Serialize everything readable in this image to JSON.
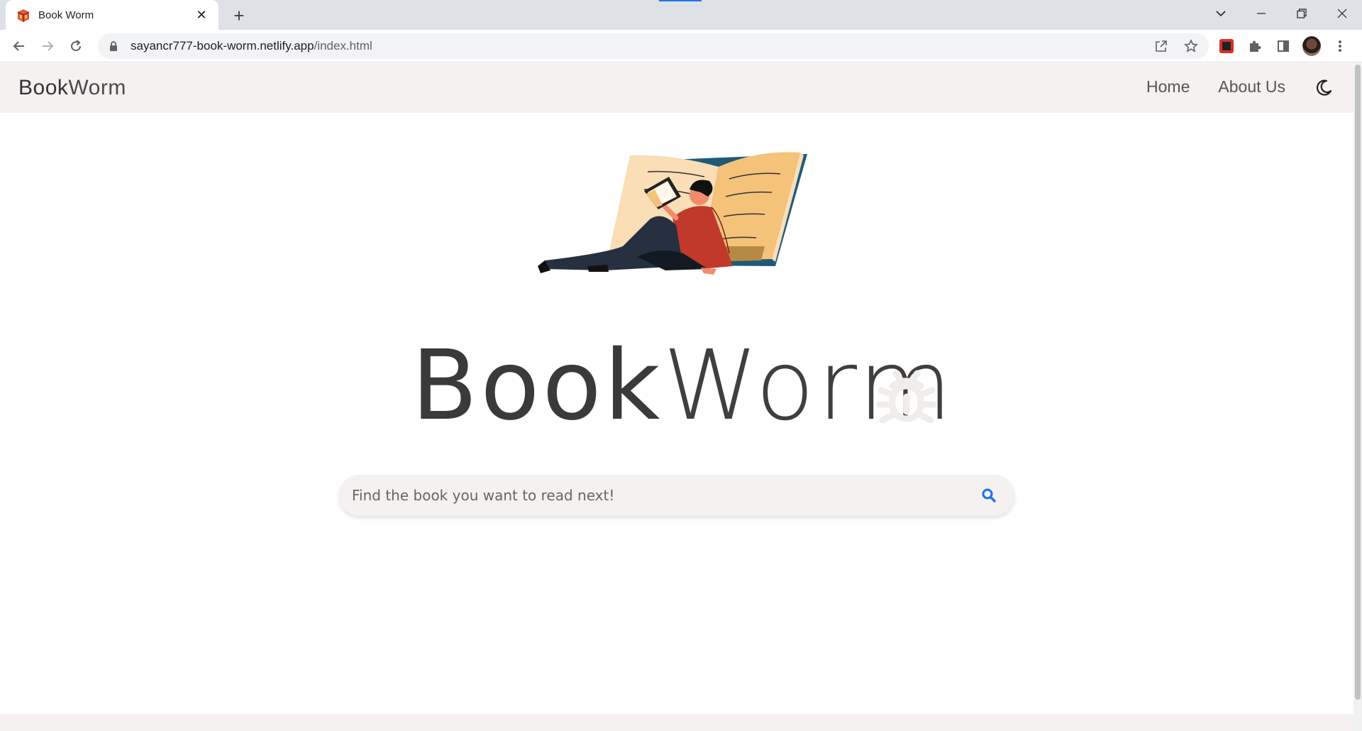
{
  "browser": {
    "tab": {
      "title": "Book Worm",
      "close_glyph": "✕",
      "favicon": "book-box-icon"
    },
    "new_tab_glyph": "+",
    "url": {
      "host": "sayancr777-book-worm.netlify.app",
      "path": "/index.html"
    }
  },
  "site": {
    "brand": {
      "part1": "Book",
      "part2": "Worm"
    },
    "nav": [
      {
        "label": "Home"
      },
      {
        "label": "About Us"
      }
    ],
    "theme_icon": "moon-icon"
  },
  "hero": {
    "logo_part1": "Book",
    "logo_part2": "Worm",
    "logo_icon": "bug-icon"
  },
  "search": {
    "placeholder": "Find the book you want to read next!",
    "value": "",
    "icon": "search-icon",
    "accent": "#1a73e8"
  },
  "colors": {
    "nav_bg": "#f4f1f0",
    "text_dark": "#3a3a3a"
  }
}
